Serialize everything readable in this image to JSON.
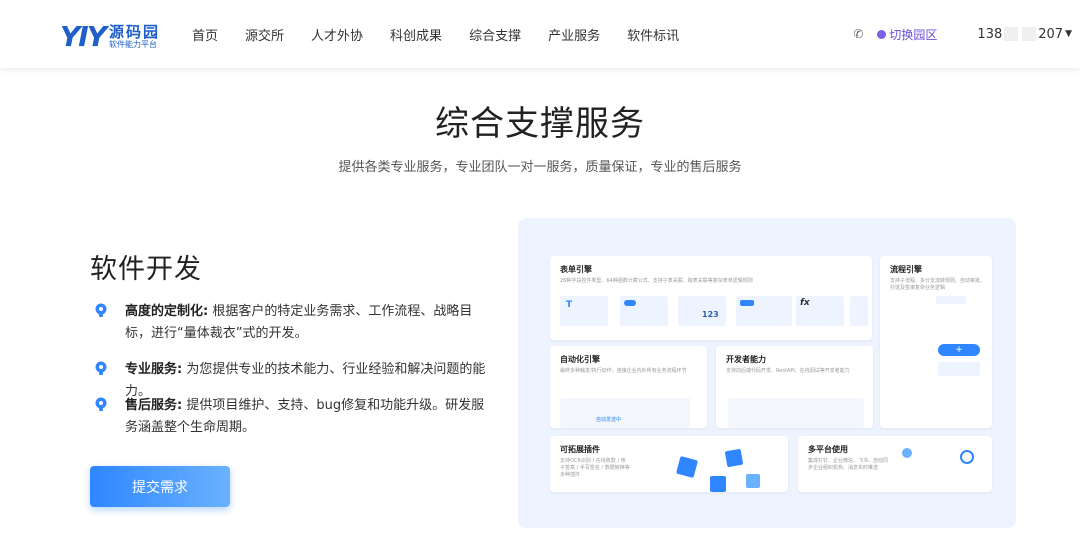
{
  "header": {
    "logo_mark": "YIY",
    "logo_name": "源码园",
    "logo_sub": "软件能力平台",
    "nav": [
      "首页",
      "源交所",
      "人才外协",
      "科创成果",
      "综合支撑",
      "产业服务",
      "软件标讯"
    ],
    "switch_label": "切换园区",
    "user_prefix": "138",
    "user_suffix": "207"
  },
  "hero": {
    "title": "综合支撑服务",
    "subtitle": "提供各类专业服务，专业团队一对一服务，质量保证，专业的售后服务"
  },
  "section": {
    "title": "软件开发",
    "features": [
      {
        "label": "高度的定制化:",
        "text": " 根据客户的特定业务需求、工作流程、战略目标，进行“量体裁衣”式的开发。"
      },
      {
        "label": "专业服务:",
        "text": " 为您提供专业的技术能力、行业经验和解决问题的能力。"
      },
      {
        "label": "售后服务:",
        "text": " 提供项目维护、支持、bug修复和功能升级。研发服务涵盖整个生命周期。"
      }
    ],
    "cta_label": "提交需求"
  },
  "illustration": {
    "cards": [
      {
        "title": "表单引擎",
        "desc": "26种字段控件类型、64种函数计算公式、支持子表关联、跨表关联等复杂表单逻辑规则"
      },
      {
        "title": "流程引擎",
        "desc": "支持子流程、多分支流转规则、自动审批、抄送及签审复杂业务逻辑"
      },
      {
        "title": "自动化引擎",
        "desc": "最终多种触发/执行动作，连接企业内外所有业务流程环节"
      },
      {
        "title": "开发者能力",
        "desc": "支持前后端代码开发、RestAPI、在线调试等开发者能力"
      },
      {
        "title": "可拓展插件",
        "desc": "支持OCR识别 / 在线收款 / 电子签章 / 手写签名 / 数据转换等多种插件"
      },
      {
        "title": "多平台使用",
        "desc": "集成钉钉、企业微信、飞书、自动同步企业组织机构、消息实时推送"
      }
    ],
    "number_sample": "123",
    "auto_label": "自动发送中"
  },
  "colors": {
    "accent": "#2f86ff",
    "brand": "#1e5fc8",
    "switch": "#6a4fd6"
  }
}
